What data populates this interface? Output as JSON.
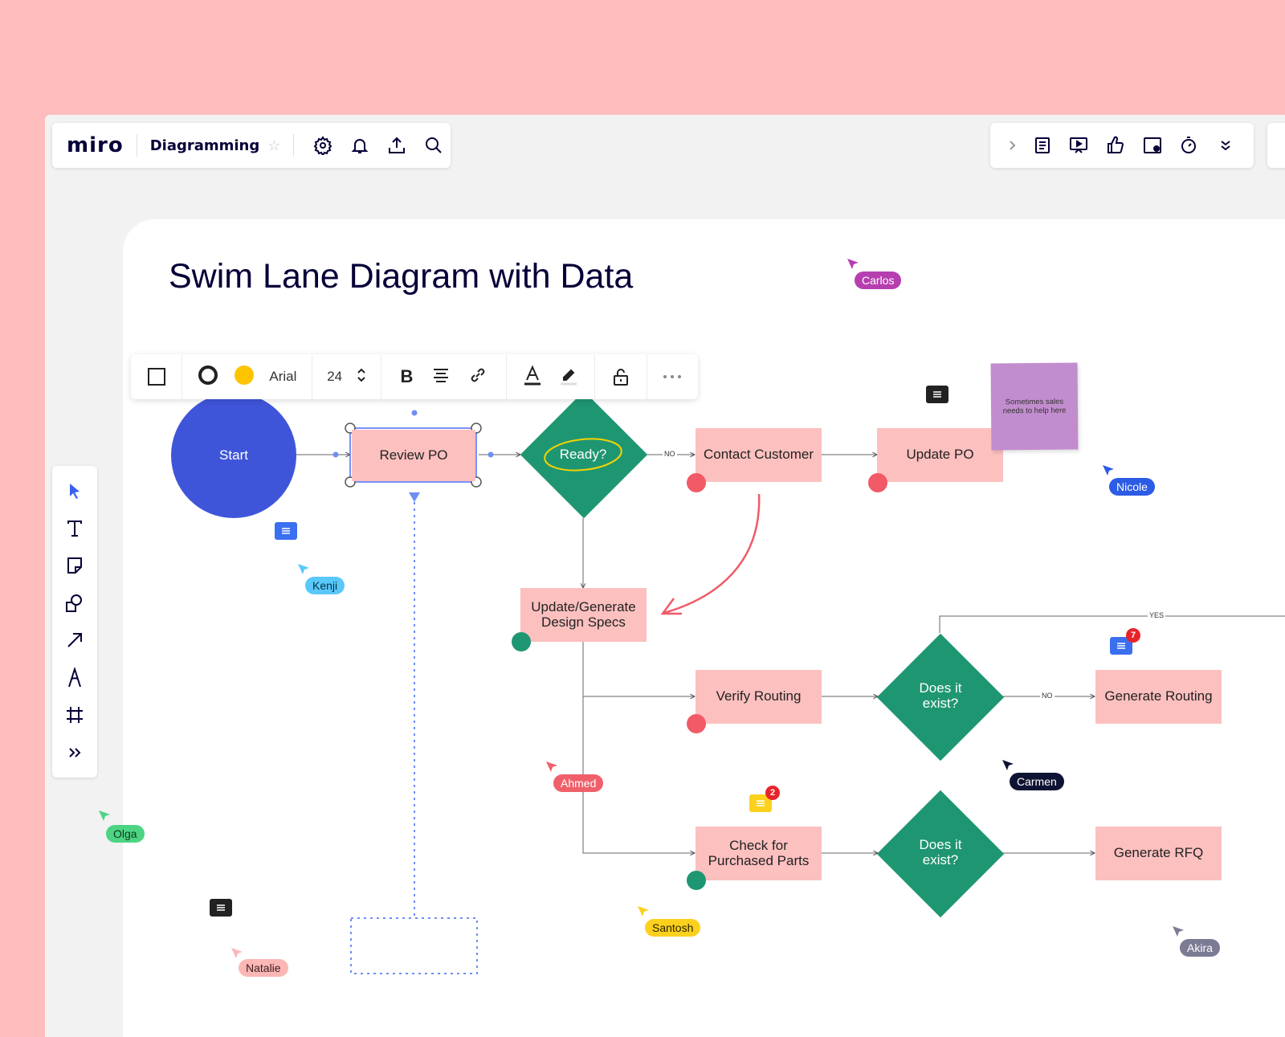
{
  "app": {
    "logo": "miro",
    "board_name": "Diagramming"
  },
  "top_toolbar": {
    "icons": [
      "settings-icon",
      "bell-icon",
      "upload-icon",
      "search-icon"
    ],
    "right_icons": [
      "chevron-right-icon",
      "notes-icon",
      "present-icon",
      "like-icon",
      "screen-icon",
      "timer-icon",
      "more-down-icon"
    ]
  },
  "context_toolbar": {
    "font": "Arial",
    "font_size": "24",
    "fill_color": "#ffc400"
  },
  "canvas": {
    "title": "Swim Lane Diagram with Data",
    "sticky_note": "Sometimes sales needs to help here"
  },
  "nodes": {
    "start": "Start",
    "review_po": "Review PO",
    "ready": "Ready?",
    "contact_customer": "Contact Customer",
    "update_po": "Update PO",
    "update_generate": "Update/Generate Design Specs",
    "verify_routing": "Verify Routing",
    "does_exist_1": "Does it exist?",
    "generate_routing": "Generate Routing",
    "check_parts": "Check for Purchased Parts",
    "does_exist_2": "Does it exist?",
    "generate_rfq": "Generate RFQ"
  },
  "edge_labels": {
    "no_1": "NO",
    "no_2": "NO",
    "yes": "YES"
  },
  "comments": {
    "routing_count": "7",
    "parts_count": "2"
  },
  "collaborators": [
    {
      "name": "Carlos",
      "color": "#b63fb0",
      "text": "#ffffff"
    },
    {
      "name": "Nicole",
      "color": "#2c5be6",
      "text": "#ffffff"
    },
    {
      "name": "Kenji",
      "color": "#5ac8fa",
      "text": "#003344"
    },
    {
      "name": "Ahmed",
      "color": "#f0606a",
      "text": "#ffffff"
    },
    {
      "name": "Carmen",
      "color": "#0f1333",
      "text": "#ffffff"
    },
    {
      "name": "Olga",
      "color": "#4cd483",
      "text": "#0d3b1e"
    },
    {
      "name": "Natalie",
      "color": "#fbb7b6",
      "text": "#3a1a1a"
    },
    {
      "name": "Santosh",
      "color": "#fcd11e",
      "text": "#2a2200"
    },
    {
      "name": "Akira",
      "color": "#7b7b94",
      "text": "#ffffff"
    }
  ],
  "colors": {
    "background": "#ffbdbd",
    "start_node": "#3f55d9",
    "decision": "#1f9672",
    "process": "#fcc0bf",
    "sticky": "#c28dce",
    "accent_red": "#f15a66",
    "accent_green": "#1f9672"
  }
}
